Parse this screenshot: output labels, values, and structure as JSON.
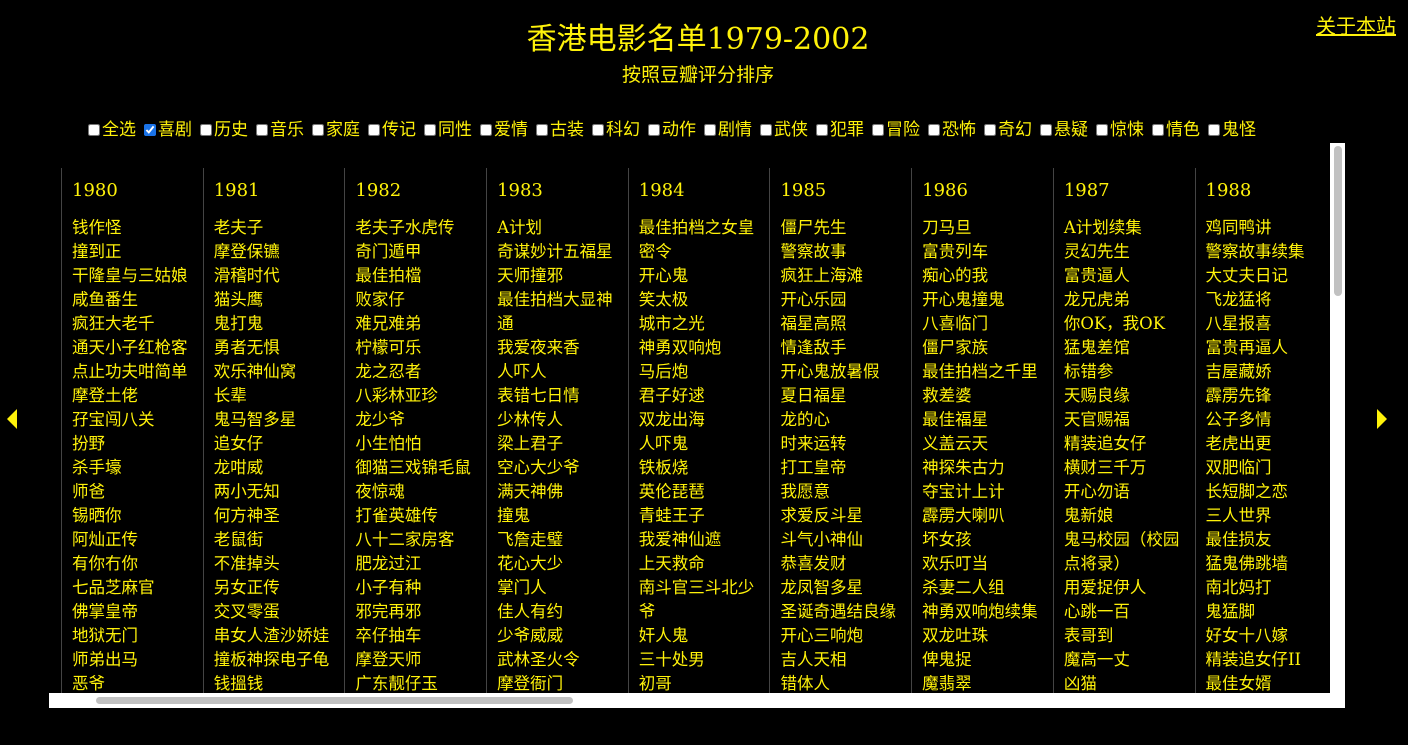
{
  "header": {
    "title": "香港电影名单1979-2002",
    "subtitle": "按照豆瓣评分排序",
    "about_link": "关于本站"
  },
  "filters": [
    {
      "label": "全选",
      "checked": false
    },
    {
      "label": "喜剧",
      "checked": true
    },
    {
      "label": "历史",
      "checked": false
    },
    {
      "label": "音乐",
      "checked": false
    },
    {
      "label": "家庭",
      "checked": false
    },
    {
      "label": "传记",
      "checked": false
    },
    {
      "label": "同性",
      "checked": false
    },
    {
      "label": "爱情",
      "checked": false
    },
    {
      "label": "古装",
      "checked": false
    },
    {
      "label": "科幻",
      "checked": false
    },
    {
      "label": "动作",
      "checked": false
    },
    {
      "label": "剧情",
      "checked": false
    },
    {
      "label": "武侠",
      "checked": false
    },
    {
      "label": "犯罪",
      "checked": false
    },
    {
      "label": "冒险",
      "checked": false
    },
    {
      "label": "恐怖",
      "checked": false
    },
    {
      "label": "奇幻",
      "checked": false
    },
    {
      "label": "悬疑",
      "checked": false
    },
    {
      "label": "惊悚",
      "checked": false
    },
    {
      "label": "情色",
      "checked": false
    },
    {
      "label": "鬼怪",
      "checked": false
    }
  ],
  "years": [
    {
      "year": "1980",
      "films": [
        "钱作怪",
        "撞到正",
        "干隆皇与三姑娘",
        "咸鱼番生",
        "疯狂大老千",
        "通天小子红枪客",
        "点止功夫咁简单",
        "摩登土佬",
        "孖宝闯八关",
        "扮野",
        "杀手壕",
        "师爸",
        "锡晒你",
        "阿灿正传",
        "有你冇你",
        "七品芝麻官",
        "佛掌皇帝",
        "地狱无门",
        "师弟出马",
        "恶爷"
      ]
    },
    {
      "year": "1981",
      "films": [
        "老夫子",
        "摩登保镳",
        "滑稽时代",
        "猫头鹰",
        "鬼打鬼",
        "勇者无惧",
        "欢乐神仙窝",
        "长辈",
        "鬼马智多星",
        "追女仔",
        "龙咁威",
        "两小无知",
        "何方神圣",
        "老鼠街",
        "不准掉头",
        "另女正传",
        "交叉零蛋",
        "串女人渣沙娇娃",
        "撞板神探电子龟",
        "钱搵钱"
      ]
    },
    {
      "year": "1982",
      "films": [
        "老夫子水虎传",
        "奇门遁甲",
        "最佳拍檔",
        "败家仔",
        "难兄难弟",
        "柠檬可乐",
        "龙之忍者",
        "八彩林亚珍",
        "龙少爷",
        "小生怕怕",
        "御猫三戏锦毛鼠",
        "夜惊魂",
        "打雀英雄传",
        "八十二家房客",
        "肥龙过江",
        "小子有种",
        "邪完再邪",
        "卒仔抽车",
        "摩登天师",
        "广东靓仔玉"
      ]
    },
    {
      "year": "1983",
      "films": [
        "A计划",
        "奇谋妙计五福星",
        "天师撞邪",
        "最佳拍档大显神通",
        "我爱夜来香",
        "人吓人",
        "表错七日情",
        "少林传人",
        "梁上君子",
        "空心大少爷",
        "满天神佛",
        "撞鬼",
        "飞詹走璧",
        "花心大少",
        "掌门人",
        "佳人有约",
        "少爷威威",
        "武林圣火令",
        "摩登衙门"
      ]
    },
    {
      "year": "1984",
      "films": [
        "最佳拍档之女皇密令",
        "开心鬼",
        "笑太极",
        "城市之光",
        "神勇双响炮",
        "马后炮",
        "君子好逑",
        "双龙出海",
        "人吓鬼",
        "铁板烧",
        "英伦琵琶",
        "青蛙王子",
        "我爱神仙遮",
        "上天救命",
        "南斗官三斗北少爷",
        "奸人鬼",
        "三十处男",
        "初哥"
      ]
    },
    {
      "year": "1985",
      "films": [
        "僵尸先生",
        "警察故事",
        "疯狂上海滩",
        "开心乐园",
        "福星高照",
        "情逢敌手",
        "开心鬼放暑假",
        "夏日福星",
        "龙的心",
        "时来运转",
        "打工皇帝",
        "我愿意",
        "求爱反斗星",
        "斗气小神仙",
        "恭喜发财",
        "龙凤智多星",
        "圣诞奇遇结良缘",
        "开心三响炮",
        "吉人天相",
        "错体人"
      ]
    },
    {
      "year": "1986",
      "films": [
        "刀马旦",
        "富贵列车",
        "痴心的我",
        "开心鬼撞鬼",
        "八喜临门",
        "僵尸家族",
        "最佳拍档之千里救差婆",
        "最佳福星",
        "义盖云天",
        "神探朱古力",
        "夺宝计上计",
        "霹雳大喇叭",
        "坏女孩",
        "欢乐叮当",
        "杀妻二人组",
        "神勇双响炮续集",
        "双龙吐珠",
        "俾鬼捉",
        "魔翡翠"
      ]
    },
    {
      "year": "1987",
      "films": [
        "A计划续集",
        "灵幻先生",
        "富贵逼人",
        "龙兄虎弟",
        "你OK，我OK",
        "猛鬼差馆",
        "标错参",
        "天赐良缘",
        "天官赐福",
        "精装追女仔",
        "横财三千万",
        "开心勿语",
        "鬼新娘",
        "鬼马校园（校园点将录）",
        "用爱捉伊人",
        "心跳一百",
        "表哥到",
        "魔高一丈",
        "凶猫"
      ]
    },
    {
      "year": "1988",
      "films": [
        "鸡同鸭讲",
        "警察故事续集",
        "大丈夫日记",
        "飞龙猛将",
        "八星报喜",
        "富贵再逼人",
        "吉屋藏娇",
        "霹雳先锋",
        "公子多情",
        "老虎出更",
        "双肥临门",
        "长短脚之恋",
        "三人世界",
        "最佳损友",
        "猛鬼佛跳墙",
        "南北妈打",
        "鬼猛脚",
        "好女十八嫁",
        "精装追女仔II",
        "最佳女婿"
      ]
    }
  ]
}
